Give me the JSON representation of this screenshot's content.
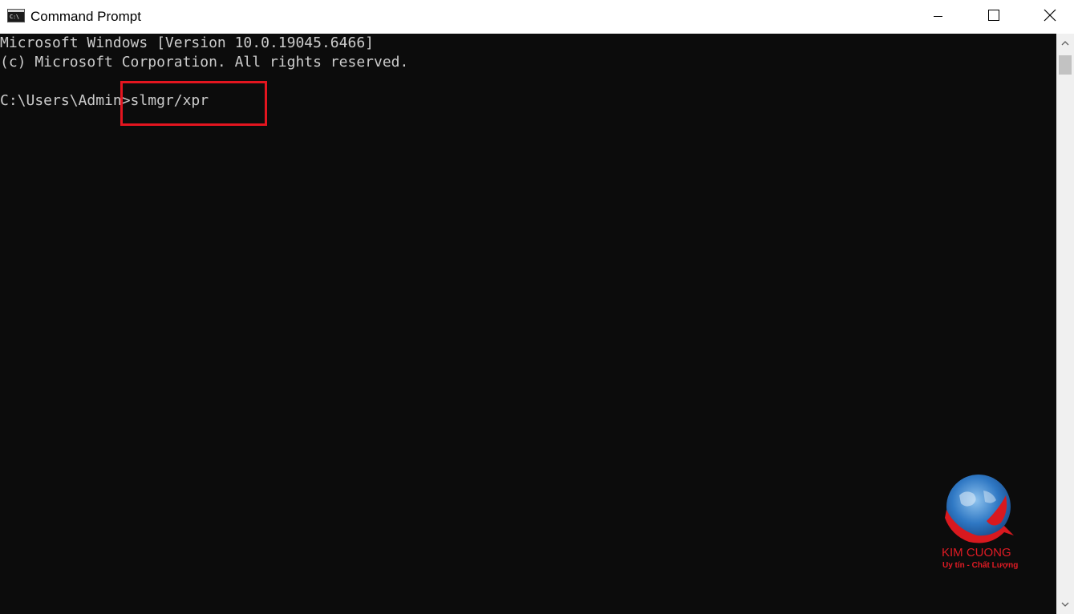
{
  "window": {
    "title": "Command Prompt",
    "icon": "cmd-icon",
    "icon_text": "C:\\",
    "controls": {
      "minimize_icon": "minimize-icon",
      "maximize_icon": "maximize-icon",
      "close_icon": "close-icon"
    }
  },
  "console": {
    "lines": [
      "Microsoft Windows [Version 10.0.19045.6466]",
      "(c) Microsoft Corporation. All rights reserved.",
      "C:\\Users\\Admin>slmgr/xpr"
    ],
    "highlight_color": "#e3151f",
    "background": "#0c0c0c",
    "text_color": "#cccccc"
  },
  "scrollbar": {
    "up_icon": "scroll-up-arrow-icon",
    "down_icon": "scroll-down-arrow-icon"
  },
  "watermark": {
    "brand": "KIM CUONG",
    "slogan": "Uy tín - Chất Lượng",
    "logo_icon": "globe-logo-icon",
    "color": "#e01b24"
  }
}
